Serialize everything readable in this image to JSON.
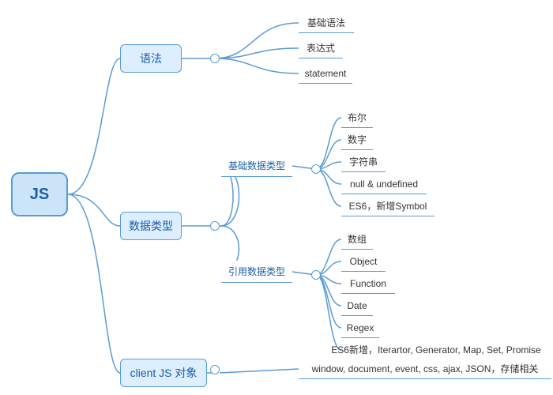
{
  "root": {
    "label": "JS"
  },
  "l1": {
    "yufa": "语法",
    "shuju": "数据类型",
    "client": "client JS 对象"
  },
  "l2": {
    "jichu": "基础数据类型",
    "yinyong": "引用数据类型"
  },
  "yufa_leaves": [
    "基础语法",
    "表达式",
    "statement"
  ],
  "jichu_leaves": [
    "布尔",
    "数字",
    "字符串",
    "null & undefined",
    "ES6，新增Symbol"
  ],
  "yinyong_leaves": [
    "数组",
    "Object",
    "Function",
    "Date",
    "Regex",
    "ES6新增，Iterartor, Generator, Map, Set, Promise"
  ],
  "client_leaf": "window, document, event, css, ajax, JSON，存储相关"
}
